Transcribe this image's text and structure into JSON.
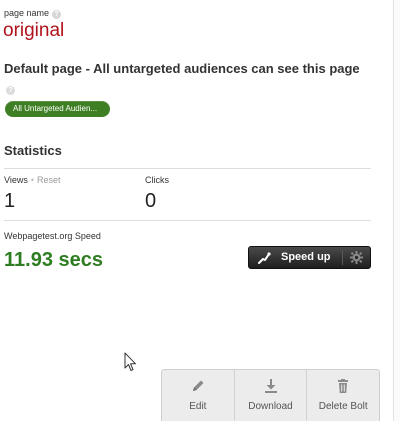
{
  "page_name": {
    "label": "page name",
    "value": "original"
  },
  "default_text": "Default page - All untargeted audiences can see this page",
  "audience_pill": "All Untargeted Audien...",
  "statistics": {
    "heading": "Statistics",
    "views_label": "Views",
    "reset_label": "Reset",
    "views_value": "1",
    "clicks_label": "Clicks",
    "clicks_value": "0"
  },
  "speed": {
    "label": "Webpagetest.org Speed",
    "value": "11.93 secs",
    "button_label": "Speed up"
  },
  "toolbar": {
    "edit_label": "Edit",
    "download_label": "Download",
    "delete_label": "Delete Bolt"
  },
  "colors": {
    "page_name": "#b0121b",
    "speed_value": "#2f7d22",
    "audience_pill": "#3f7f24"
  },
  "icons": [
    "help-icon",
    "bolt-icon",
    "gear-icon",
    "pencil-icon",
    "download-icon",
    "trash-icon",
    "cursor-icon"
  ]
}
